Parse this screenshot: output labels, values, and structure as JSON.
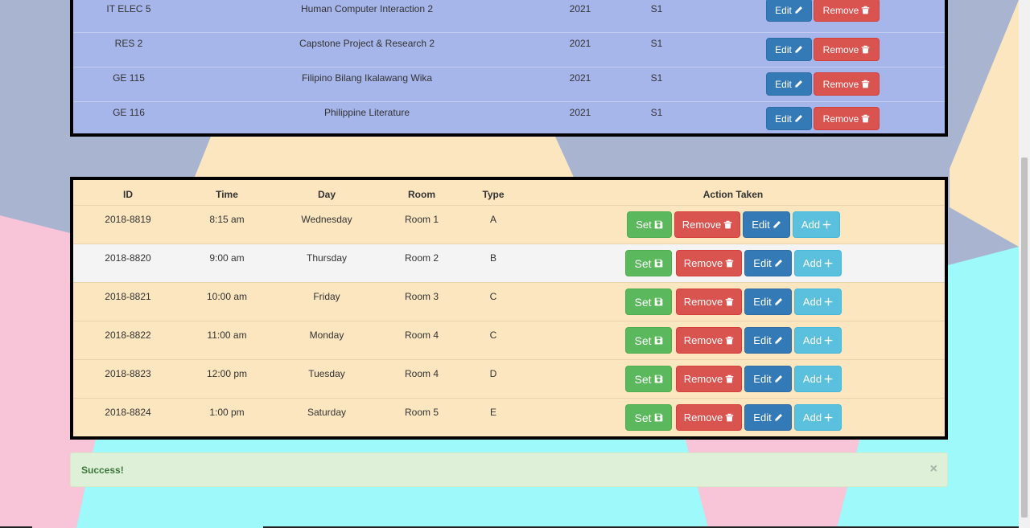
{
  "subjects": [
    {
      "code": "IT ELEC 5",
      "description": "Human Computer Interaction 2",
      "year": "2021",
      "semester": "S1"
    },
    {
      "code": "RES 2",
      "description": "Capstone Project & Research 2",
      "year": "2021",
      "semester": "S1"
    },
    {
      "code": "GE 115",
      "description": "Filipino Bilang Ikalawang Wika",
      "year": "2021",
      "semester": "S1"
    },
    {
      "code": "GE 116",
      "description": "Philippine Literature",
      "year": "2021",
      "semester": "S1"
    }
  ],
  "subject_actions": {
    "edit": "Edit",
    "remove": "Remove"
  },
  "schedule": {
    "headers": {
      "id": "ID",
      "time": "Time",
      "day": "Day",
      "room": "Room",
      "type": "Type",
      "action": "Action Taken"
    },
    "actions": {
      "set": "Set",
      "remove": "Remove",
      "edit": "Edit",
      "add": "Add"
    },
    "rows": [
      {
        "id": "2018-8819",
        "time": "8:15 am",
        "day": "Wednesday",
        "room": "Room 1",
        "type": "A"
      },
      {
        "id": "2018-8820",
        "time": "9:00 am",
        "day": "Thursday",
        "room": "Room 2",
        "type": "B"
      },
      {
        "id": "2018-8821",
        "time": "10:00 am",
        "day": "Friday",
        "room": "Room 3",
        "type": "C"
      },
      {
        "id": "2018-8822",
        "time": "11:00 am",
        "day": "Monday",
        "room": "Room 4",
        "type": "C"
      },
      {
        "id": "2018-8823",
        "time": "12:00 pm",
        "day": "Tuesday",
        "room": "Room 4",
        "type": "D"
      },
      {
        "id": "2018-8824",
        "time": "1:00 pm",
        "day": "Saturday",
        "room": "Room 5",
        "type": "E"
      }
    ]
  },
  "alert": {
    "message": "Success!",
    "close": "×"
  },
  "colors": {
    "edit": "#337ab7",
    "remove": "#d9534f",
    "set": "#5cb85c",
    "add": "#5bc0de",
    "subjects_bg": "#a6b5ea",
    "schedule_bg": "#fbe6bf",
    "alert_bg": "#dff0d8"
  },
  "icons": {
    "edit": "pencil-icon",
    "remove": "trash-icon",
    "set": "floppy-disk-icon",
    "add": "plus-icon"
  }
}
